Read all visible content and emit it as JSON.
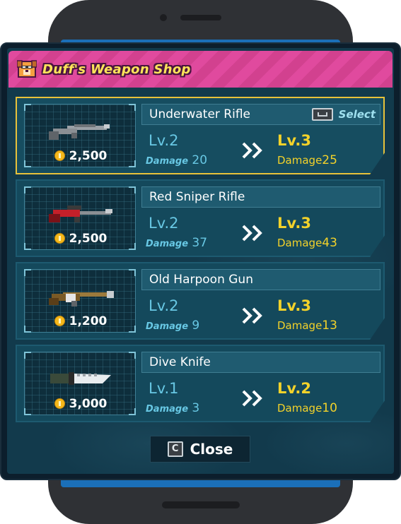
{
  "shop": {
    "title": "Duff's Weapon Shop",
    "icon": "dog-face-icon"
  },
  "select_label": "Select",
  "damage_label": "Damage",
  "items": [
    {
      "name": "Underwater Rifle",
      "price": "2,500",
      "cur_level": "Lv.2",
      "cur_damage": "20",
      "new_level": "Lv.3",
      "new_damage": "25",
      "selected": true,
      "icon": "rifle-icon"
    },
    {
      "name": "Red Sniper Rifle",
      "price": "2,500",
      "cur_level": "Lv.2",
      "cur_damage": "37",
      "new_level": "Lv.3",
      "new_damage": "43",
      "selected": false,
      "icon": "sniper-rifle-icon"
    },
    {
      "name": "Old Harpoon Gun",
      "price": "1,200",
      "cur_level": "Lv.2",
      "cur_damage": "9",
      "new_level": "Lv.3",
      "new_damage": "13",
      "selected": false,
      "icon": "harpoon-gun-icon"
    },
    {
      "name": "Dive Knife",
      "price": "3,000",
      "cur_level": "Lv.1",
      "cur_damage": "3",
      "new_level": "Lv.2",
      "new_damage": "10",
      "selected": false,
      "icon": "knife-icon"
    }
  ],
  "close": {
    "key": "C",
    "label": "Close"
  },
  "colors": {
    "header": "#e04a9e",
    "title": "#ffe45a",
    "current": "#68c8e4",
    "upgrade": "#f3d22a",
    "selected_border": "#e8c23a"
  }
}
